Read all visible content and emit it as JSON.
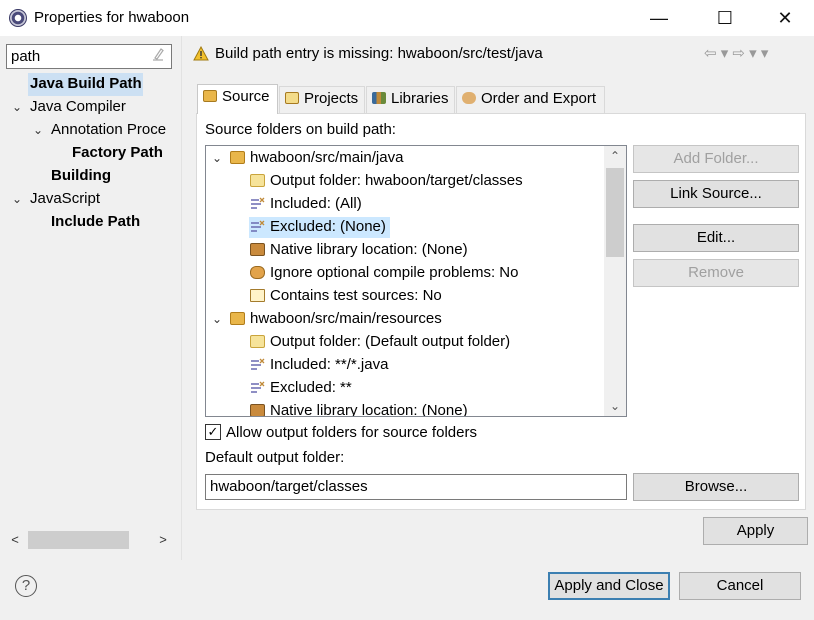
{
  "window": {
    "title": "Properties for hwaboon",
    "minimize_glyph": "—",
    "maximize_glyph": "☐",
    "close_glyph": "✕"
  },
  "sidebar": {
    "filter_value": "path",
    "items": [
      {
        "label": "Java Build Path",
        "bold": true,
        "twisty": ""
      },
      {
        "label": "Java Compiler",
        "bold": false,
        "twisty": "⌄"
      },
      {
        "label": "Annotation Proce",
        "bold": false,
        "twisty": "⌄"
      },
      {
        "label": "Factory Path",
        "bold": true,
        "twisty": ""
      },
      {
        "label": "Building",
        "bold": true,
        "twisty": ""
      },
      {
        "label": "JavaScript",
        "bold": false,
        "twisty": "⌄"
      },
      {
        "label": "Include Path",
        "bold": true,
        "twisty": ""
      }
    ],
    "scroll_left": "<",
    "scroll_right": ">"
  },
  "header": {
    "message": "Build path entry is missing: hwaboon/src/test/java",
    "nav_glyphs": "⇦ ▾ ⇨ ▾ ▾"
  },
  "tabs": [
    {
      "label": "Source",
      "active": true,
      "icon": "source-folder-icon",
      "color": "#e9b64a"
    },
    {
      "label": "Projects",
      "active": false,
      "icon": "projects-icon",
      "color": "#e9b64a"
    },
    {
      "label": "Libraries",
      "active": false,
      "icon": "libraries-icon",
      "color": "#7a6a3a"
    },
    {
      "label": "Order and Export",
      "active": false,
      "icon": "order-export-icon",
      "color": "#c08a3a"
    }
  ],
  "source": {
    "section_label": "Source folders on build path:",
    "rows": [
      {
        "label": "hwaboon/src/main/java",
        "indent": 0,
        "twisty": "⌄",
        "icon": "package-folder-icon"
      },
      {
        "label": "Output folder: hwaboon/target/classes",
        "indent": 1,
        "icon": "output-folder-icon"
      },
      {
        "label": "Included: (All)",
        "indent": 1,
        "icon": "inclusion-filter-icon"
      },
      {
        "label": "Excluded: (None)",
        "indent": 1,
        "icon": "exclusion-filter-icon",
        "selected": true
      },
      {
        "label": "Native library location: (None)",
        "indent": 1,
        "icon": "native-library-icon"
      },
      {
        "label": "Ignore optional compile problems: No",
        "indent": 1,
        "icon": "ignore-problems-icon"
      },
      {
        "label": "Contains test sources: No",
        "indent": 1,
        "icon": "test-sources-icon"
      },
      {
        "label": "hwaboon/src/main/resources",
        "indent": 0,
        "twisty": "⌄",
        "icon": "package-folder-icon"
      },
      {
        "label": "Output folder: (Default output folder)",
        "indent": 1,
        "icon": "output-folder-icon"
      },
      {
        "label": "Included: **/*.java",
        "indent": 1,
        "icon": "inclusion-filter-icon"
      },
      {
        "label": "Excluded: **",
        "indent": 1,
        "icon": "exclusion-filter-icon"
      },
      {
        "label": "Native library location: (None)",
        "indent": 1,
        "icon": "native-library-icon"
      }
    ],
    "scroll_up": "⌃",
    "scroll_down": "⌄"
  },
  "buttons": {
    "add_folder": "Add Folder...",
    "link_source": "Link Source...",
    "edit": "Edit...",
    "remove": "Remove",
    "browse": "Browse...",
    "apply": "Apply",
    "apply_and_close": "Apply and Close",
    "cancel": "Cancel"
  },
  "options": {
    "allow_output_label": "Allow output folders for source folders",
    "allow_output_checked": true,
    "check_glyph": "✓",
    "default_output_label": "Default output folder:",
    "default_output_value": "hwaboon/target/classes"
  },
  "footer": {
    "help_glyph": "?"
  },
  "colors": {
    "selection": "#cce8ff",
    "tree_selection": "#cce0f3",
    "default_button_border": "#3c7fb1",
    "warning": "#f2c12e"
  }
}
